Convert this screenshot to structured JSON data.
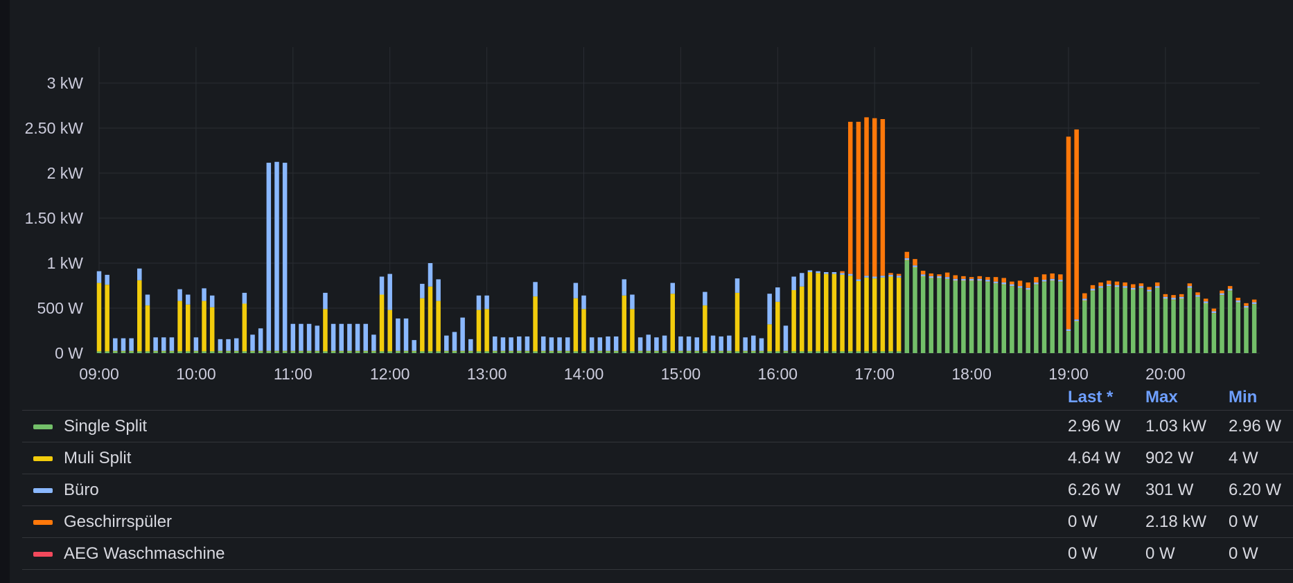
{
  "chart_data": {
    "type": "bar",
    "stacked": true,
    "x": [
      "09:00",
      "09:05",
      "09:10",
      "09:15",
      "09:20",
      "09:25",
      "09:30",
      "09:35",
      "09:40",
      "09:45",
      "09:50",
      "09:55",
      "10:00",
      "10:05",
      "10:10",
      "10:15",
      "10:20",
      "10:25",
      "10:30",
      "10:35",
      "10:40",
      "10:45",
      "10:50",
      "10:55",
      "11:00",
      "11:05",
      "11:10",
      "11:15",
      "11:20",
      "11:25",
      "11:30",
      "11:35",
      "11:40",
      "11:45",
      "11:50",
      "11:55",
      "12:00",
      "12:05",
      "12:10",
      "12:15",
      "12:20",
      "12:25",
      "12:30",
      "12:35",
      "12:40",
      "12:45",
      "12:50",
      "12:55",
      "13:00",
      "13:05",
      "13:10",
      "13:15",
      "13:20",
      "13:25",
      "13:30",
      "13:35",
      "13:40",
      "13:45",
      "13:50",
      "13:55",
      "14:00",
      "14:05",
      "14:10",
      "14:15",
      "14:20",
      "14:25",
      "14:30",
      "14:35",
      "14:40",
      "14:45",
      "14:50",
      "14:55",
      "15:00",
      "15:05",
      "15:10",
      "15:15",
      "15:20",
      "15:25",
      "15:30",
      "15:35",
      "15:40",
      "15:45",
      "15:50",
      "15:55",
      "16:00",
      "16:05",
      "16:10",
      "16:15",
      "16:20",
      "16:25",
      "16:30",
      "16:35",
      "16:40",
      "16:45",
      "16:50",
      "16:55",
      "17:00",
      "17:05",
      "17:10",
      "17:15",
      "17:20",
      "17:25",
      "17:30",
      "17:35",
      "17:40",
      "17:45",
      "17:50",
      "17:55",
      "18:00",
      "18:05",
      "18:10",
      "18:15",
      "18:20",
      "18:25",
      "18:30",
      "18:35",
      "18:40",
      "18:45",
      "18:50",
      "18:55",
      "19:00",
      "19:05",
      "19:10",
      "19:15",
      "19:20",
      "19:25",
      "19:30",
      "19:35",
      "19:40",
      "19:45",
      "19:50",
      "19:55",
      "20:00",
      "20:05",
      "20:10",
      "20:15",
      "20:20",
      "20:25",
      "20:30",
      "20:35",
      "20:40",
      "20:45",
      "20:50",
      "20:55"
    ],
    "series": [
      {
        "name": "Single Split",
        "color": "#73bf69",
        "values": [
          20,
          20,
          20,
          20,
          20,
          20,
          20,
          20,
          20,
          20,
          20,
          20,
          20,
          20,
          20,
          20,
          20,
          20,
          20,
          20,
          20,
          20,
          20,
          20,
          20,
          20,
          20,
          20,
          20,
          20,
          20,
          20,
          20,
          20,
          20,
          20,
          20,
          20,
          20,
          20,
          20,
          20,
          20,
          20,
          20,
          20,
          20,
          20,
          20,
          20,
          20,
          20,
          20,
          20,
          20,
          20,
          20,
          20,
          20,
          20,
          20,
          20,
          20,
          20,
          20,
          20,
          20,
          20,
          20,
          20,
          20,
          20,
          20,
          20,
          20,
          20,
          20,
          20,
          20,
          20,
          20,
          20,
          20,
          20,
          20,
          20,
          20,
          20,
          20,
          20,
          20,
          20,
          20,
          20,
          20,
          20,
          20,
          20,
          20,
          20,
          1030,
          950,
          850,
          830,
          830,
          820,
          800,
          800,
          800,
          800,
          790,
          770,
          760,
          740,
          720,
          700,
          760,
          790,
          800,
          790,
          240,
          350,
          580,
          690,
          720,
          740,
          730,
          720,
          700,
          720,
          680,
          720,
          600,
          590,
          600,
          720,
          620,
          550,
          440,
          640,
          690,
          560,
          500,
          540,
          70,
          30
        ]
      },
      {
        "name": "Muli Split",
        "color": "#f2cc0c",
        "values": [
          760,
          740,
          5,
          5,
          5,
          790,
          510,
          5,
          5,
          5,
          560,
          520,
          5,
          560,
          490,
          5,
          5,
          5,
          530,
          5,
          5,
          5,
          5,
          5,
          5,
          5,
          5,
          5,
          470,
          5,
          5,
          5,
          5,
          5,
          5,
          630,
          460,
          5,
          5,
          5,
          590,
          720,
          560,
          5,
          5,
          5,
          5,
          460,
          470,
          5,
          5,
          5,
          5,
          5,
          610,
          5,
          5,
          5,
          5,
          590,
          470,
          5,
          5,
          5,
          5,
          620,
          470,
          5,
          5,
          5,
          5,
          640,
          5,
          5,
          5,
          510,
          5,
          5,
          5,
          650,
          5,
          5,
          5,
          300,
          550,
          5,
          680,
          720,
          880,
          870,
          860,
          860,
          850,
          840,
          780,
          820,
          810,
          820,
          830,
          820,
          5,
          5,
          5,
          5,
          5,
          5,
          5,
          5,
          5,
          5,
          5,
          5,
          5,
          5,
          5,
          5,
          5,
          5,
          5,
          5,
          5,
          5,
          5,
          5,
          5,
          5,
          5,
          5,
          5,
          5,
          5,
          5,
          5,
          5,
          5,
          5,
          5,
          5,
          5,
          5,
          5,
          5,
          5,
          5,
          5,
          5
        ]
      },
      {
        "name": "Büro",
        "color": "#8ab8ff",
        "values": [
          130,
          110,
          140,
          140,
          140,
          130,
          120,
          150,
          150,
          150,
          130,
          110,
          150,
          140,
          130,
          130,
          130,
          140,
          120,
          180,
          250,
          2090,
          2100,
          2090,
          300,
          300,
          300,
          280,
          180,
          300,
          300,
          300,
          300,
          300,
          180,
          200,
          400,
          360,
          360,
          120,
          160,
          260,
          240,
          170,
          210,
          370,
          130,
          160,
          150,
          160,
          150,
          150,
          160,
          160,
          160,
          160,
          150,
          150,
          150,
          170,
          150,
          150,
          150,
          160,
          160,
          180,
          160,
          150,
          180,
          150,
          170,
          120,
          160,
          160,
          150,
          150,
          170,
          160,
          170,
          160,
          150,
          170,
          140,
          340,
          160,
          280,
          150,
          150,
          20,
          20,
          20,
          20,
          20,
          20,
          20,
          20,
          20,
          20,
          20,
          20,
          20,
          20,
          20,
          20,
          20,
          20,
          20,
          20,
          20,
          20,
          20,
          20,
          20,
          20,
          20,
          20,
          20,
          20,
          20,
          20,
          20,
          20,
          20,
          20,
          20,
          20,
          20,
          20,
          20,
          20,
          20,
          20,
          20,
          20,
          20,
          20,
          20,
          20,
          20,
          20,
          20,
          20,
          20,
          20,
          20,
          20,
          20,
          20,
          20,
          20
        ]
      },
      {
        "name": "Geschirrspüler",
        "color": "#ff780a",
        "values": [
          0,
          0,
          0,
          0,
          0,
          0,
          0,
          0,
          0,
          0,
          0,
          0,
          0,
          0,
          0,
          0,
          0,
          0,
          0,
          0,
          0,
          0,
          0,
          0,
          0,
          0,
          0,
          0,
          0,
          0,
          0,
          0,
          0,
          0,
          0,
          0,
          0,
          0,
          0,
          0,
          0,
          0,
          0,
          0,
          0,
          0,
          0,
          0,
          0,
          0,
          0,
          0,
          0,
          0,
          0,
          0,
          0,
          0,
          0,
          0,
          0,
          0,
          0,
          0,
          0,
          0,
          0,
          0,
          0,
          0,
          0,
          0,
          0,
          0,
          0,
          0,
          0,
          0,
          0,
          0,
          0,
          0,
          0,
          0,
          0,
          0,
          0,
          0,
          0,
          0,
          0,
          0,
          20,
          1690,
          1750,
          1760,
          1760,
          1740,
          20,
          20,
          70,
          70,
          40,
          30,
          20,
          50,
          40,
          30,
          20,
          30,
          30,
          50,
          50,
          30,
          60,
          60,
          60,
          60,
          60,
          60,
          2140,
          2110,
          60,
          40,
          40,
          40,
          40,
          40,
          40,
          30,
          30,
          40,
          30,
          30,
          30,
          30,
          30,
          30,
          30,
          30,
          30,
          30,
          30,
          30,
          30,
          30,
          30,
          30,
          30,
          30,
          30,
          30,
          30,
          30
        ]
      },
      {
        "name": "AEG Waschmaschine",
        "color": "#f2495c",
        "values": [
          0,
          0,
          0,
          0,
          0,
          0,
          0,
          0,
          0,
          0,
          0,
          0,
          0,
          0,
          0,
          0,
          0,
          0,
          0,
          0,
          0,
          0,
          0,
          0,
          0,
          0,
          0,
          0,
          0,
          0,
          0,
          0,
          0,
          0,
          0,
          0,
          0,
          0,
          0,
          0,
          0,
          0,
          0,
          0,
          0,
          0,
          0,
          0,
          0,
          0,
          0,
          0,
          0,
          0,
          0,
          0,
          0,
          0,
          0,
          0,
          0,
          0,
          0,
          0,
          0,
          0,
          0,
          0,
          0,
          0,
          0,
          0,
          0,
          0,
          0,
          0,
          0,
          0,
          0,
          0,
          0,
          0,
          0,
          0,
          0,
          0,
          0,
          0,
          0,
          0,
          0,
          0,
          0,
          0,
          0,
          0,
          0,
          0,
          0,
          0,
          0,
          0,
          0,
          0,
          0,
          0,
          0,
          0,
          0,
          0,
          0,
          0,
          0,
          0,
          0,
          0,
          0,
          0,
          0,
          0,
          0,
          0,
          0,
          0,
          0,
          0,
          0,
          0,
          0,
          0,
          0,
          0,
          0,
          0,
          0,
          0,
          0,
          0,
          0,
          0,
          0,
          0,
          0,
          0,
          0,
          0,
          0,
          0,
          0,
          0
        ]
      }
    ],
    "x_ticks": [
      "09:00",
      "10:00",
      "11:00",
      "12:00",
      "13:00",
      "14:00",
      "15:00",
      "16:00",
      "17:00",
      "18:00",
      "19:00",
      "20:00"
    ],
    "y_ticks": [
      {
        "value": 0,
        "label": "0 W"
      },
      {
        "value": 500,
        "label": "500 W"
      },
      {
        "value": 1000,
        "label": "1 kW"
      },
      {
        "value": 1500,
        "label": "1.50 kW"
      },
      {
        "value": 2000,
        "label": "2 kW"
      },
      {
        "value": 2500,
        "label": "2.50 kW"
      },
      {
        "value": 3000,
        "label": "3 kW"
      }
    ],
    "ylim": [
      0,
      3400
    ],
    "grid": true,
    "legend_placement": "bottom-table"
  },
  "legend": {
    "headers": {
      "last": "Last *",
      "max": "Max",
      "min": "Min"
    },
    "rows": [
      {
        "name": "Single Split",
        "color": "#73bf69",
        "last": "2.96 W",
        "max": "1.03 kW",
        "min": "2.96 W"
      },
      {
        "name": "Muli Split",
        "color": "#f2cc0c",
        "last": "4.64 W",
        "max": "902 W",
        "min": "4 W"
      },
      {
        "name": "Büro",
        "color": "#8ab8ff",
        "last": "6.26 W",
        "max": "301 W",
        "min": "6.20 W"
      },
      {
        "name": "Geschirrspüler",
        "color": "#ff780a",
        "last": "0 W",
        "max": "2.18 kW",
        "min": "0 W"
      },
      {
        "name": "AEG Waschmaschine",
        "color": "#f2495c",
        "last": "0 W",
        "max": "0 W",
        "min": "0 W"
      }
    ]
  }
}
